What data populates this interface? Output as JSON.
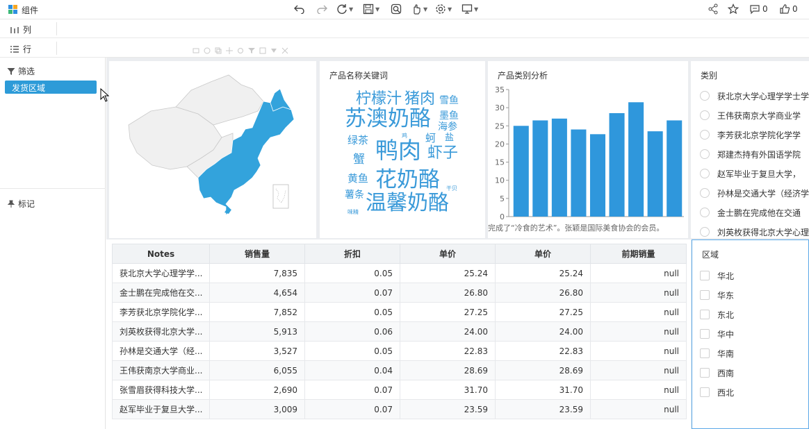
{
  "app": {
    "title": "组件"
  },
  "toolbar": {
    "comments_count": "0",
    "likes_count": "0"
  },
  "shelves": {
    "columns_label": "列",
    "rows_label": "行"
  },
  "left_panel": {
    "filter_title": "筛选",
    "filter_chip": "发货区域",
    "mark_title": "标记"
  },
  "map_card": {
    "title": ""
  },
  "wordcloud": {
    "title": "产品名称关键词",
    "words": [
      {
        "text": "柠檬汁",
        "size": 22
      },
      {
        "text": "猪肉",
        "size": 22
      },
      {
        "text": "雪鱼",
        "size": 14
      },
      {
        "text": "苏澳奶酪",
        "size": 31
      },
      {
        "text": "墨鱼",
        "size": 14
      },
      {
        "text": "海参",
        "size": 14
      },
      {
        "text": "绿茶",
        "size": 15
      },
      {
        "text": "鸡",
        "size": 8
      },
      {
        "text": "蚵",
        "size": 15
      },
      {
        "text": "盐",
        "size": 13
      },
      {
        "text": "鸭肉",
        "size": 33
      },
      {
        "text": "虾子",
        "size": 22
      },
      {
        "text": "蟹",
        "size": 17
      },
      {
        "text": "黄鱼",
        "size": 15
      },
      {
        "text": "花奶酪",
        "size": 31
      },
      {
        "text": "薯条",
        "size": 14
      },
      {
        "text": "干贝",
        "size": 8
      },
      {
        "text": "温馨奶酪",
        "size": 30
      },
      {
        "text": "味精",
        "size": 8
      }
    ]
  },
  "bar_card": {
    "title": "产品类别分析",
    "footer_text": "完成了“冷食的艺术”。张颖是国际美食协会的会员。"
  },
  "chart_data": {
    "type": "bar",
    "title": "产品类别分析",
    "categories": [
      "",
      "",
      "",
      "",
      "",
      "",
      "",
      "",
      "",
      ""
    ],
    "values": [
      25,
      26.5,
      27,
      24,
      22.7,
      28.5,
      31.5,
      23.5,
      26.5
    ],
    "ylim": [
      0,
      35
    ],
    "yticks": [
      "0",
      "5",
      "10",
      "15",
      "20",
      "25",
      "30",
      "35"
    ],
    "grid": false,
    "color": "#2f97dc"
  },
  "table": {
    "headers": [
      "Notes",
      "销售量",
      "折扣",
      "单价",
      "单价",
      "前期销量"
    ],
    "rows": [
      [
        "获北京大学心理学学...",
        "7,835",
        "0.05",
        "25.24",
        "25.24",
        "null"
      ],
      [
        "金士鹏在完成他在交...",
        "4,654",
        "0.07",
        "26.80",
        "26.80",
        "null"
      ],
      [
        "李芳获北京学院化学...",
        "7,852",
        "0.05",
        "27.25",
        "27.25",
        "null"
      ],
      [
        "刘英枚获得北京大学...",
        "5,913",
        "0.06",
        "24.00",
        "24.00",
        "null"
      ],
      [
        "孙林是交通大学（经...",
        "3,527",
        "0.05",
        "22.83",
        "22.83",
        "null"
      ],
      [
        "王伟获南京大学商业...",
        "6,055",
        "0.04",
        "28.69",
        "28.69",
        "null"
      ],
      [
        "张雪眉获得科技大学...",
        "2,690",
        "0.07",
        "31.70",
        "31.70",
        "null"
      ],
      [
        "赵军毕业于复旦大学...",
        "3,009",
        "0.07",
        "23.59",
        "23.59",
        "null"
      ]
    ]
  },
  "category_filter": {
    "title": "类别",
    "options": [
      "获北京大学心理学学士学",
      "王伟获南京大学商业学",
      "李芳获北京学院化学学",
      "郑建杰持有外国语学院",
      "赵军毕业于复旦大学，",
      "孙林是交通大学（经济学",
      "金士鹏在完成他在交通",
      "刘英枚获得北京大学心理"
    ]
  },
  "region_filter": {
    "title": "区域",
    "options": [
      "华北",
      "华东",
      "东北",
      "华中",
      "华南",
      "西南",
      "西北"
    ]
  },
  "colors": {
    "accent": "#2d9bd8",
    "map_highlight": "#33a3dc",
    "bar": "#2f97dc"
  }
}
